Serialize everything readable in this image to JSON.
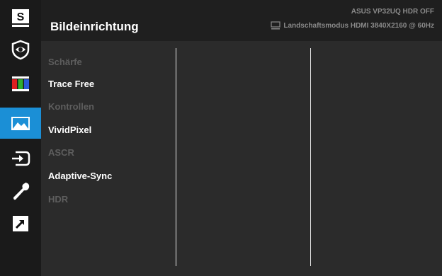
{
  "header": {
    "title": "Bildeinrichtung",
    "status_line1": "ASUS  VP32UQ  HDR OFF",
    "status_line2": "Landschaftsmodus HDMI 3840X2160 @ 60Hz"
  },
  "sidebar": {
    "items": [
      {
        "icon": "splendid-s-icon",
        "active": false
      },
      {
        "icon": "eye-care-icon",
        "active": false
      },
      {
        "icon": "color-bars-icon",
        "active": false
      },
      {
        "icon": "image-mountain-icon",
        "active": true
      },
      {
        "icon": "input-select-icon",
        "active": false
      },
      {
        "icon": "wrench-system-icon",
        "active": false
      },
      {
        "icon": "shortcut-arrow-icon",
        "active": false
      }
    ],
    "s_label": "S"
  },
  "menu": {
    "items": [
      {
        "label": "Schärfe",
        "enabled": false
      },
      {
        "label": "Trace Free",
        "enabled": true
      },
      {
        "label": "Kontrollen",
        "enabled": false
      },
      {
        "label": "VividPixel",
        "enabled": true
      },
      {
        "label": "ASCR",
        "enabled": false
      },
      {
        "label": "Adaptive-Sync",
        "enabled": true
      },
      {
        "label": "HDR",
        "enabled": false
      }
    ]
  },
  "colors": {
    "accent": "#1b8fd6",
    "enabled_text": "#ffffff",
    "disabled_text": "#5e5e5e"
  }
}
